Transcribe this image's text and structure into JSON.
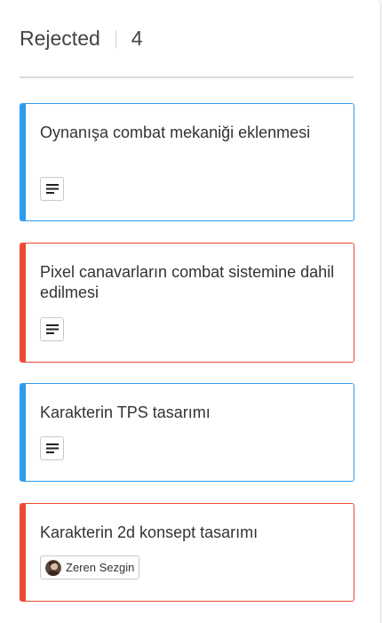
{
  "column": {
    "title": "Rejected",
    "count": "4"
  },
  "cards": [
    {
      "title": "Oynanışa combat mekaniği eklenmesi",
      "accent_color": "#2d9bf0",
      "has_description": true
    },
    {
      "title": "Pixel canavarların combat sistemine dahil edilmesi",
      "accent_color": "#eb4a33",
      "has_description": true
    },
    {
      "title": "Karakterin TPS tasarımı",
      "accent_color": "#2d9bf0",
      "has_description": true
    },
    {
      "title": "Karakterin 2d konsept tasarımı",
      "accent_color": "#eb4a33",
      "assignee": "Zeren Sezgin"
    }
  ],
  "icons": {
    "description": "description-icon",
    "avatar": "user-avatar"
  }
}
